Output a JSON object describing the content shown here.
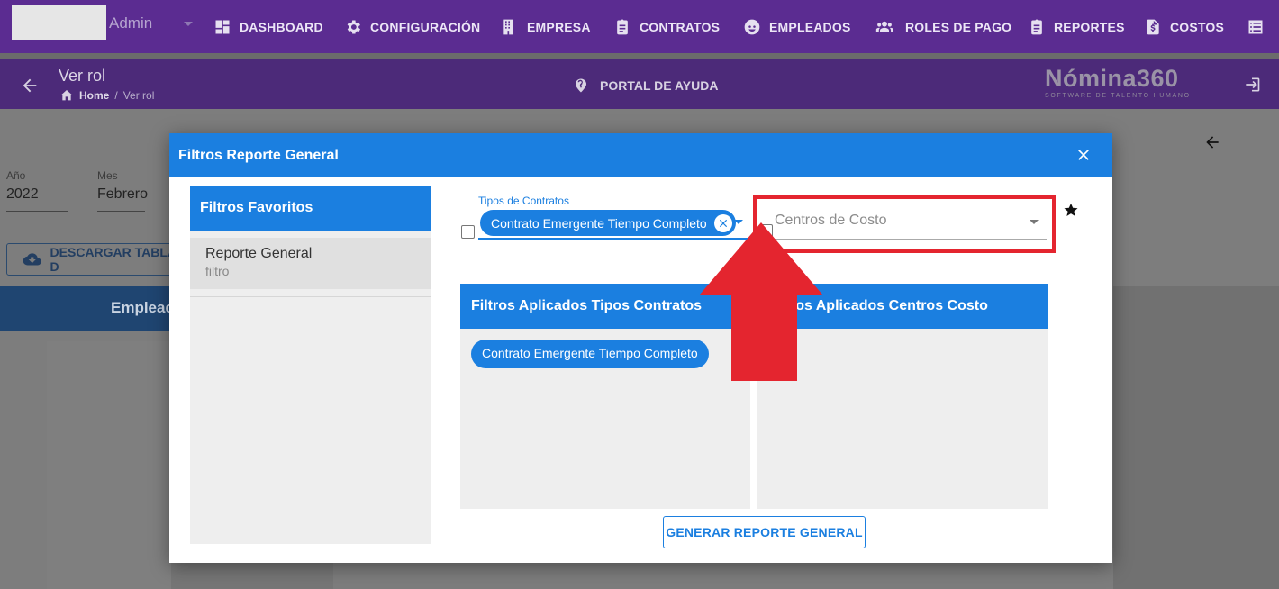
{
  "topnav": {
    "user_role": "Admin",
    "items": [
      {
        "label": "DASHBOARD",
        "icon": "dashboard-icon"
      },
      {
        "label": "CONFIGURACIÓN",
        "icon": "gear-icon"
      },
      {
        "label": "EMPRESA",
        "icon": "building-icon"
      },
      {
        "label": "CONTRATOS",
        "icon": "clipboard-icon"
      },
      {
        "label": "EMPLEADOS",
        "icon": "face-icon"
      },
      {
        "label": "ROLES DE PAGO",
        "icon": "people-icon"
      },
      {
        "label": "REPORTES",
        "icon": "clipboard-icon"
      },
      {
        "label": "COSTOS",
        "icon": "invoice-icon"
      },
      {
        "label": "",
        "icon": "list-icon"
      }
    ]
  },
  "header": {
    "title": "Ver rol",
    "breadcrumb_home": "Home",
    "breadcrumb_sep": "/",
    "breadcrumb_current": "Ver rol",
    "help_label": "PORTAL DE AYUDA",
    "brand_name": "Nómina360",
    "brand_tag": "SOFTWARE DE TALENTO HUMANO"
  },
  "background": {
    "year_label": "Año",
    "year_value": "2022",
    "month_label": "Mes",
    "month_value": "Febrero",
    "download_label": "DESCARGAR TABLA D",
    "employee_header": "Emplead"
  },
  "modal": {
    "title": "Filtros Reporte General",
    "favorites": {
      "title": "Filtros Favoritos",
      "items": [
        {
          "title": "Reporte General",
          "subtitle": "filtro"
        }
      ]
    },
    "contract_types": {
      "label": "Tipos de Contratos",
      "selected_chip": "Contrato Emergente Tiempo Completo"
    },
    "cost_centers": {
      "placeholder": "Centros de Costo"
    },
    "applied_contracts": {
      "title": "Filtros Aplicados Tipos Contratos",
      "chips": [
        "Contrato Emergente Tiempo Completo"
      ]
    },
    "applied_costs": {
      "title": "Filtros Aplicados Centros Costo"
    },
    "generate_button": "GENERAR REPORTE GENERAL"
  },
  "colors": {
    "nav_bg": "#5b2c91",
    "primary": "#1b7fe0",
    "highlight": "#e4252f"
  }
}
